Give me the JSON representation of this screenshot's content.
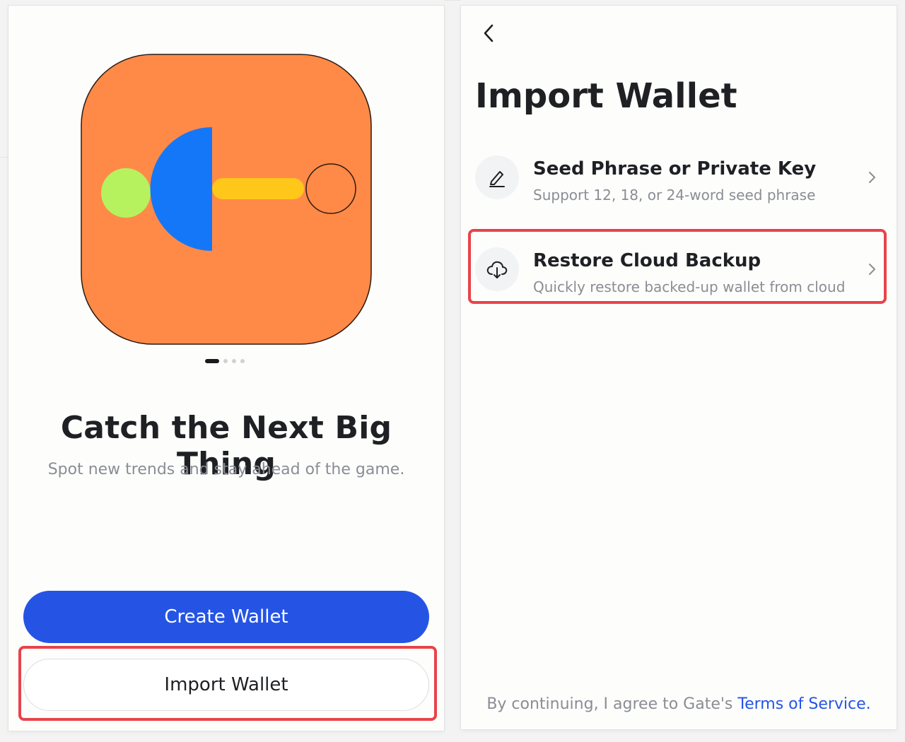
{
  "colors": {
    "primary": "#2554e5",
    "highlight": "#e8434a",
    "logo_bg": "#ff8a48",
    "logo_green": "#b6f25e",
    "logo_blue": "#1477f8",
    "logo_yellow": "#ffc71a"
  },
  "onboarding": {
    "carousel": {
      "total": 4,
      "active": 0
    },
    "title": "Catch the Next Big Thing",
    "subtitle": "Spot new trends and stay ahead of the game.",
    "create_button": "Create Wallet",
    "import_button": "Import Wallet"
  },
  "import_screen": {
    "back_icon": "chevron-left-icon",
    "title": "Import Wallet",
    "options": [
      {
        "icon": "pen-icon",
        "title": "Seed Phrase or Private Key",
        "subtitle": "Support 12, 18, or 24-word seed phrase"
      },
      {
        "icon": "cloud-download-icon",
        "title": "Restore Cloud Backup",
        "subtitle": "Quickly restore backed-up wallet from cloud"
      }
    ],
    "footer": {
      "prefix": "By continuing, I agree to Gate's ",
      "link": "Terms of Service",
      "suffix": "."
    }
  }
}
